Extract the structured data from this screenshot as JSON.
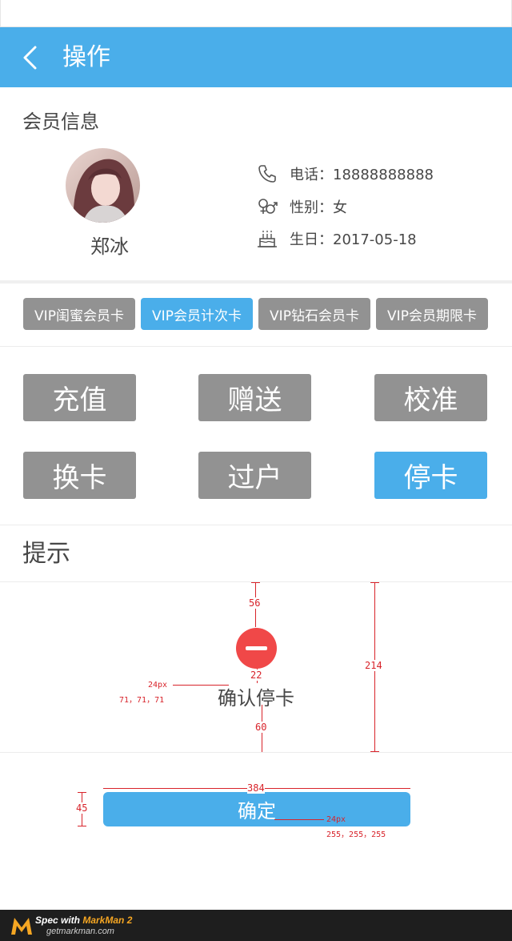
{
  "header": {
    "title": "操作"
  },
  "member": {
    "section_title": "会员信息",
    "name": "郑冰",
    "phone": "电话：18888888888",
    "gender": "性别：女",
    "birthday": "生日：2017-05-18"
  },
  "card_tabs": [
    {
      "label": "VIP闺蜜会员卡",
      "active": false
    },
    {
      "label": "VIP会员计次卡",
      "active": true
    },
    {
      "label": "VIP钻石会员卡",
      "active": false
    },
    {
      "label": "VIP会员期限卡",
      "active": false
    }
  ],
  "operations": [
    {
      "label": "充值",
      "active": false
    },
    {
      "label": "赠送",
      "active": false
    },
    {
      "label": "校准",
      "active": false
    },
    {
      "label": "换卡",
      "active": false
    },
    {
      "label": "过户",
      "active": false
    },
    {
      "label": "停卡",
      "active": true
    }
  ],
  "hint": {
    "title": "提示",
    "message": "确认停卡",
    "confirm_label": "确定"
  },
  "annotations": {
    "top_gap": "56",
    "icon_gap": "22",
    "bottom_gap": "60",
    "block_height": "214",
    "text_size": "24px",
    "text_color": "71，71，71",
    "button_width": "384",
    "button_height": "45",
    "button_text_size": "24px",
    "button_text_color": "255，255，255"
  },
  "footer": {
    "spec_prefix": "Spec with ",
    "brand": "MarkMan 2",
    "site": "getmarkman.com"
  },
  "colors": {
    "primary": "#4aaeea",
    "inactive": "#929292",
    "danger": "#f04848",
    "annotation": "#d8232a"
  }
}
